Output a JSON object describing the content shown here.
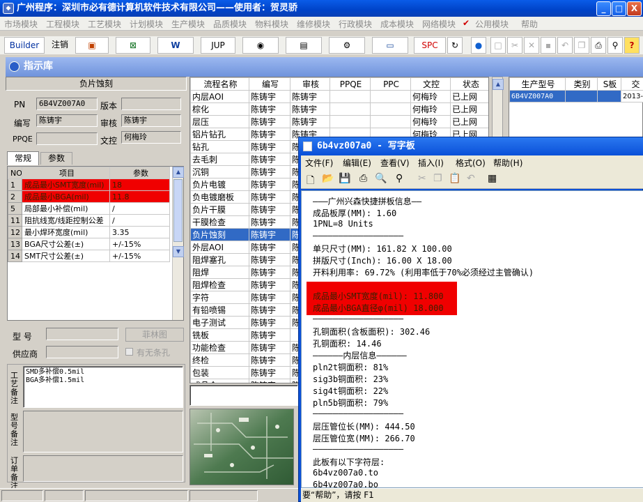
{
  "window": {
    "title": "广州程序：深圳市必有德计算机软件技术有限公司——使用者：贺灵骄",
    "minimize": "_",
    "maximize": "□",
    "close": "X"
  },
  "menubar": [
    "市场模块",
    "工程模块",
    "工艺模块",
    "计划模块",
    "生产模块",
    "品质模块",
    "物料模块",
    "维修模块",
    "行政模块",
    "成本模块",
    "网络模块",
    "公用模块",
    "帮助"
  ],
  "toolbar": {
    "builder": "Builder",
    "logout": "注销",
    "jup": "JUP",
    "spc": "SPC"
  },
  "child_window": {
    "title": "指示库"
  },
  "left": {
    "header": "负片蚀刻",
    "pn_label": "PN",
    "pn_value": "6B4VZ007A0",
    "version_label": "版本",
    "version_value": "",
    "writer_label": "编写",
    "writer_value": "陈铸宇",
    "reviewer_label": "审核",
    "reviewer_value": "陈铸宇",
    "ppqe_label": "PPQE",
    "ppqe_value": "",
    "doc_label": "文控",
    "doc_value": "何梅玲",
    "tabs": [
      "常规",
      "参数"
    ],
    "param_headers": [
      "NO",
      "项目",
      "参数"
    ],
    "params": [
      {
        "no": "1",
        "item": "成品最小SMT宽度(mil)",
        "value": "18",
        "hl": true
      },
      {
        "no": "2",
        "item": "成品最小BGA(mil)",
        "value": "11.8",
        "hl": true
      },
      {
        "no": "5",
        "item": "局部最小补偿(mil)",
        "value": "/",
        "hl": false
      },
      {
        "no": "11",
        "item": "阻抗线宽/线距控制公差",
        "value": "/",
        "hl": false
      },
      {
        "no": "12",
        "item": "最小焊环宽度(mil)",
        "value": "3.35",
        "hl": false
      },
      {
        "no": "13",
        "item": "BGA尺寸公差(±)",
        "value": "+/-15%",
        "hl": false
      },
      {
        "no": "14",
        "item": "SMT尺寸公差(±)",
        "value": "+/-15%",
        "hl": false
      }
    ],
    "model_label": "型  号",
    "film_button": "菲林图",
    "supplier_label": "供应商",
    "no_slot_label": "有无条孔",
    "process_note_label": "工艺备注",
    "process_note_lines": [
      "SMD多补偿0.5mil",
      "BGA多补偿1.5mil"
    ],
    "model_note_label": "型号备注",
    "order_note_label": "订单备注"
  },
  "flow": {
    "headers": [
      "流程名称",
      "编写",
      "审核",
      "PPQE",
      "PPC",
      "文控",
      "状态"
    ],
    "rows": [
      [
        "内层AOI",
        "陈铸宇",
        "陈铸宇",
        "",
        "",
        "何梅玲",
        "已上网"
      ],
      [
        "棕化",
        "陈铸宇",
        "陈铸宇",
        "",
        "",
        "何梅玲",
        "已上网"
      ],
      [
        "层压",
        "陈铸宇",
        "陈铸宇",
        "",
        "",
        "何梅玲",
        "已上网"
      ],
      [
        "铝片钻孔",
        "陈铸宇",
        "陈铸宇",
        "",
        "",
        "何梅玲",
        "已上网"
      ],
      [
        "钻孔",
        "陈铸宇",
        "陈铸宇",
        "",
        "",
        "",
        ""
      ],
      [
        "去毛刺",
        "陈铸宇",
        "陈铸宇",
        "",
        "",
        "",
        ""
      ],
      [
        "沉铜",
        "陈铸宇",
        "陈铸宇",
        "",
        "",
        "",
        ""
      ],
      [
        "负片电镀",
        "陈铸宇",
        "陈铸宇",
        "",
        "",
        "",
        ""
      ],
      [
        "负电镀磨板",
        "陈铸宇",
        "陈铸宇",
        "",
        "",
        "",
        ""
      ],
      [
        "负片干膜",
        "陈铸宇",
        "陈铸宇",
        "",
        "",
        "",
        ""
      ],
      [
        "干膜检查",
        "陈铸宇",
        "陈铸宇",
        "",
        "",
        "",
        ""
      ],
      [
        "负片蚀刻",
        "陈铸宇",
        "陈铸宇",
        "",
        "",
        "",
        ""
      ],
      [
        "外层AOI",
        "陈铸宇",
        "陈铸宇",
        "",
        "",
        "",
        ""
      ],
      [
        "阻焊塞孔",
        "陈铸宇",
        "陈铸宇",
        "",
        "",
        "",
        ""
      ],
      [
        "阻焊",
        "陈铸宇",
        "陈铸宇",
        "",
        "",
        "",
        ""
      ],
      [
        "阻焊检查",
        "陈铸宇",
        "陈铸宇",
        "",
        "",
        "",
        ""
      ],
      [
        "字符",
        "陈铸宇",
        "陈铸宇",
        "",
        "",
        "",
        ""
      ],
      [
        "有铅喷锡",
        "陈铸宇",
        "陈铸宇",
        "",
        "",
        "",
        ""
      ],
      [
        "电子测试",
        "陈铸宇",
        "陈铸宇",
        "",
        "",
        "",
        ""
      ],
      [
        "铣板",
        "陈铸宇",
        "",
        "",
        "",
        "",
        ""
      ],
      [
        "功能检查",
        "陈铸宇",
        "陈",
        "",
        "",
        "",
        ""
      ],
      [
        "终检",
        "陈铸宇",
        "陈",
        "",
        "",
        "",
        ""
      ],
      [
        "包装",
        "陈铸宇",
        "陈",
        "",
        "",
        "",
        ""
      ],
      [
        "成品仓",
        "陈铸宇",
        "陈",
        "",
        "",
        "",
        ""
      ]
    ],
    "selected_index": 11
  },
  "right": {
    "headers": [
      "生产型号",
      "类别",
      "S板",
      "交"
    ],
    "row": [
      "6B4VZ007A0",
      "",
      "",
      "2013-"
    ]
  },
  "notepad": {
    "title": "6b4vz007a0 - 写字板",
    "menu": [
      "文件(F)",
      "编辑(E)",
      "查看(V)",
      "插入(I)",
      "格式(O)",
      "帮助(H)"
    ],
    "lines": [
      "———广州兴森快捷拼板信息——",
      "成品板厚(MM): 1.60",
      "1PNL=8 Units",
      "——————————————————",
      "单只尺寸(MM): 161.82 X 100.00",
      "拼版尺寸(Inch): 16.00 X 18.00",
      "开料利用率: 69.72% (利用率低于70%必须经过主管确认)",
      "———————————————————",
      "成品最小SMT宽度(mil): 11.800",
      "成品最小BGA直径φ(mil)  18.000",
      "——————————————————",
      "孔铜面积(含板面积): 302.46",
      "孔铜面积: 14.46",
      "——————内层信息——————",
      "pln2t铜面积: 81%",
      "sig3b铜面积: 23%",
      "sig4t铜面积: 22%",
      "pln5b铜面积: 79%",
      "——————————————————",
      "层压管位长(MM): 444.50",
      "层压管位宽(MM): 266.70",
      "——————————————————",
      "此板有以下字符层:",
      "6b4vz007a0.to",
      "6b4vz007a0.bo"
    ],
    "status": "要“帮助”，请按 F1"
  },
  "colors": {
    "title": "#0a50d8",
    "highlight": "#f00000",
    "selection": "#316ac5"
  }
}
